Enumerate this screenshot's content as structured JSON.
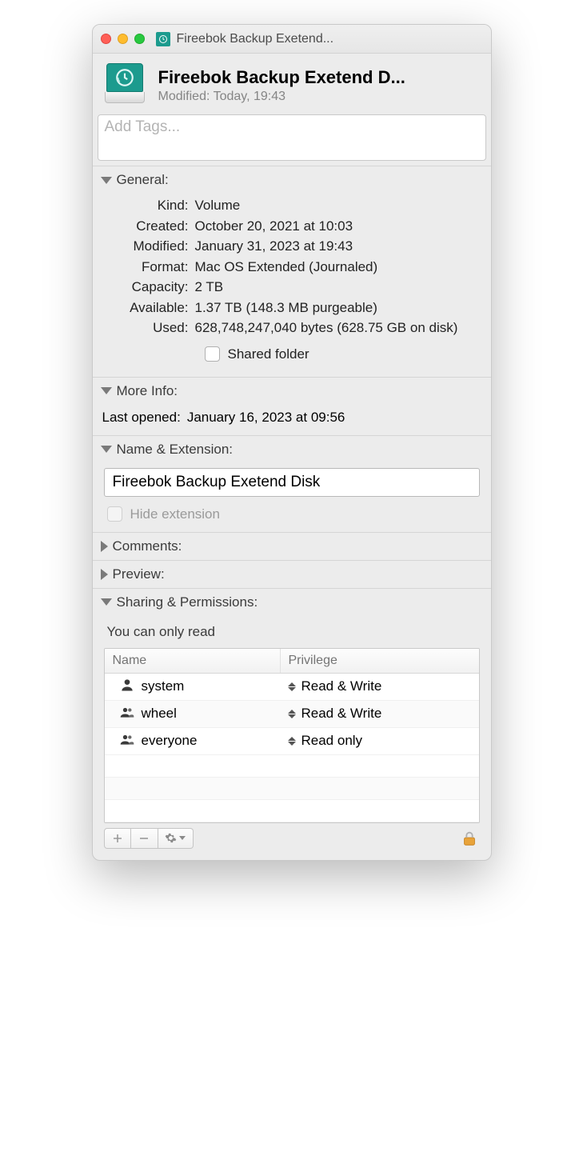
{
  "window": {
    "title": "Fireebok Backup Exetend..."
  },
  "header": {
    "title": "Fireebok Backup Exetend D...",
    "modified_label": "Modified:",
    "modified_value": "Today, 19:43"
  },
  "tags": {
    "placeholder": "Add Tags..."
  },
  "sections": {
    "general": {
      "label": "General:",
      "kind_k": "Kind:",
      "kind_v": "Volume",
      "created_k": "Created:",
      "created_v": "October 20, 2021 at 10:03",
      "modified_k": "Modified:",
      "modified_v": "January 31, 2023 at 19:43",
      "format_k": "Format:",
      "format_v": "Mac OS Extended (Journaled)",
      "capacity_k": "Capacity:",
      "capacity_v": "2 TB",
      "available_k": "Available:",
      "available_v": "1.37 TB (148.3 MB purgeable)",
      "used_k": "Used:",
      "used_v": "628,748,247,040 bytes (628.75 GB on disk)",
      "shared_label": "Shared folder"
    },
    "moreinfo": {
      "label": "More Info:",
      "lastopened_k": "Last opened:",
      "lastopened_v": "January 16, 2023 at 09:56"
    },
    "nameext": {
      "label": "Name & Extension:",
      "value": "Fireebok Backup Exetend Disk",
      "hide_label": "Hide extension"
    },
    "comments": {
      "label": "Comments:"
    },
    "preview": {
      "label": "Preview:"
    },
    "sharing": {
      "label": "Sharing & Permissions:",
      "note": "You can only read",
      "col_name": "Name",
      "col_priv": "Privilege",
      "rows": [
        {
          "name": "system",
          "priv": "Read & Write",
          "icon": "single"
        },
        {
          "name": "wheel",
          "priv": "Read & Write",
          "icon": "group"
        },
        {
          "name": "everyone",
          "priv": "Read only",
          "icon": "group"
        }
      ]
    }
  }
}
